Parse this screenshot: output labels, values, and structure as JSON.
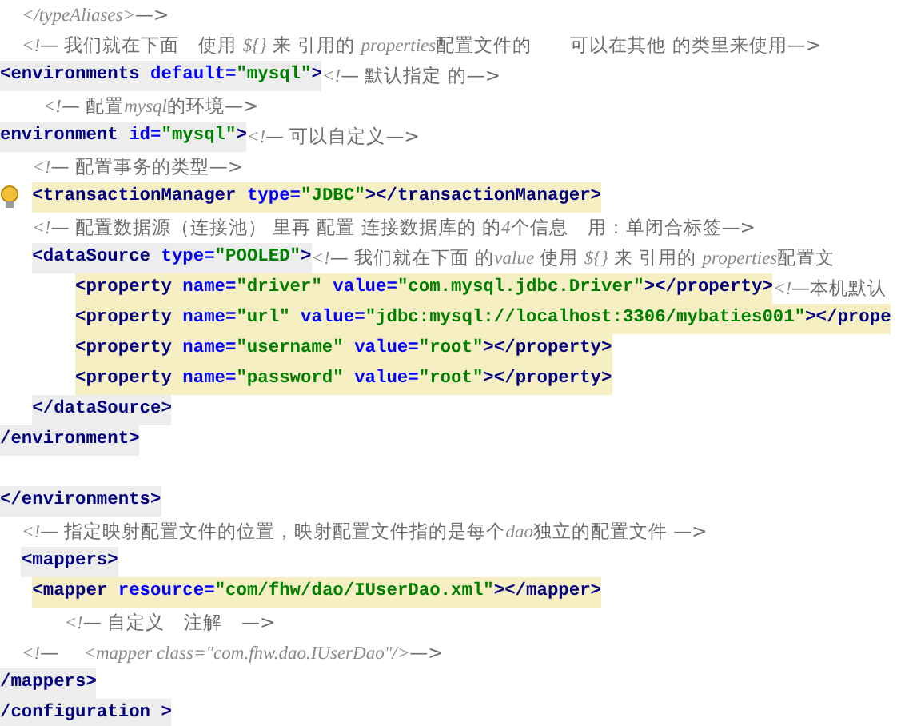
{
  "lines": [
    {
      "kind": "code",
      "comment": [
        {
          "kind": "italic",
          "text": "  </typeAliases>"
        },
        {
          "kind": "plain",
          "text": "—>"
        }
      ]
    },
    {
      "kind": "code",
      "comment": [
        {
          "kind": "italic",
          "text": "  <!"
        },
        {
          "kind": "plain",
          "text": "— 我们就在下面　使用 "
        },
        {
          "kind": "italic",
          "text": "${}"
        },
        {
          "kind": "plain",
          "text": " 来 引用的 "
        },
        {
          "kind": "italic",
          "text": "properties"
        },
        {
          "kind": "plain",
          "text": "配置文件的　　可以在其他 的类里来使用—>"
        }
      ]
    },
    {
      "kind": "code",
      "matched": false,
      "in_scope": true,
      "tokens": [
        {
          "kind": "tag",
          "text": "<environments "
        },
        {
          "kind": "attr",
          "text": "default="
        },
        {
          "kind": "value",
          "text": "\"mysql\""
        },
        {
          "kind": "tag",
          "text": ">"
        }
      ],
      "comment": [
        {
          "kind": "italic",
          "text": "<!"
        },
        {
          "kind": "plain",
          "text": "— 默认指定 的—>"
        }
      ]
    },
    {
      "kind": "code",
      "comment": [
        {
          "kind": "italic",
          "text": "    <!"
        },
        {
          "kind": "plain",
          "text": "— 配置"
        },
        {
          "kind": "italic",
          "text": "mysql"
        },
        {
          "kind": "plain",
          "text": "的环境—>"
        }
      ]
    },
    {
      "kind": "code",
      "matched": false,
      "in_scope": true,
      "tokens": [
        {
          "kind": "tag",
          "text": "environment "
        },
        {
          "kind": "attr",
          "text": "id="
        },
        {
          "kind": "value",
          "text": "\"mysql\""
        },
        {
          "kind": "tag",
          "text": ">"
        }
      ],
      "comment": [
        {
          "kind": "italic",
          "text": "<!"
        },
        {
          "kind": "plain",
          "text": "— 可以自定义—>"
        }
      ]
    },
    {
      "kind": "code",
      "comment": [
        {
          "kind": "italic",
          "text": "   <!"
        },
        {
          "kind": "plain",
          "text": "— 配置事务的类型—>"
        }
      ]
    },
    {
      "kind": "code",
      "bulb": true,
      "matched": true,
      "in_scope": false,
      "tokens": [
        {
          "kind": "tag",
          "text": "   <transactionManager "
        },
        {
          "kind": "attr",
          "text": "type="
        },
        {
          "kind": "value",
          "text": "\"JDBC\""
        },
        {
          "kind": "tag",
          "text": "></transactionManager>"
        }
      ]
    },
    {
      "kind": "code",
      "comment": [
        {
          "kind": "italic",
          "text": "   <!"
        },
        {
          "kind": "plain",
          "text": "— 配置数据源（连接池） 里再 配置 连接数据库的 的"
        },
        {
          "kind": "italic",
          "text": "4"
        },
        {
          "kind": "plain",
          "text": "个信息　用：单闭合标签—>"
        }
      ]
    },
    {
      "kind": "code",
      "matched": false,
      "in_scope": true,
      "tokens": [
        {
          "kind": "tag",
          "text": "   <dataSource "
        },
        {
          "kind": "attr",
          "text": "type="
        },
        {
          "kind": "value",
          "text": "\"POOLED\""
        },
        {
          "kind": "tag",
          "text": ">"
        }
      ],
      "comment": [
        {
          "kind": "italic",
          "text": "<!"
        },
        {
          "kind": "plain",
          "text": "— 我们就在下面 的"
        },
        {
          "kind": "italic",
          "text": "value"
        },
        {
          "kind": "plain",
          "text": " 使用 "
        },
        {
          "kind": "italic",
          "text": "${}"
        },
        {
          "kind": "plain",
          "text": " 来 引用的 "
        },
        {
          "kind": "italic",
          "text": "properties"
        },
        {
          "kind": "plain",
          "text": "配置文"
        }
      ]
    },
    {
      "kind": "code",
      "matched": true,
      "in_scope": false,
      "tokens": [
        {
          "kind": "tag",
          "text": "       <property "
        },
        {
          "kind": "attr",
          "text": "name="
        },
        {
          "kind": "value",
          "text": "\"driver\" "
        },
        {
          "kind": "attr",
          "text": "value="
        },
        {
          "kind": "value",
          "text": "\"com.mysql.jdbc.Driver\""
        },
        {
          "kind": "tag",
          "text": "></property>"
        }
      ],
      "comment": [
        {
          "kind": "italic",
          "text": "<!"
        },
        {
          "kind": "plain",
          "text": "—本机默认"
        }
      ]
    },
    {
      "kind": "code",
      "matched": true,
      "in_scope": false,
      "tokens": [
        {
          "kind": "tag",
          "text": "       <property "
        },
        {
          "kind": "attr",
          "text": "name="
        },
        {
          "kind": "value",
          "text": "\"url\" "
        },
        {
          "kind": "attr",
          "text": "value="
        },
        {
          "kind": "value",
          "text": "\"jdbc:mysql://localhost:3306/mybaties001\""
        },
        {
          "kind": "tag",
          "text": "></prope"
        }
      ]
    },
    {
      "kind": "code",
      "matched": true,
      "in_scope": false,
      "tokens": [
        {
          "kind": "tag",
          "text": "       <property "
        },
        {
          "kind": "attr",
          "text": "name="
        },
        {
          "kind": "value",
          "text": "\"username\" "
        },
        {
          "kind": "attr",
          "text": "value="
        },
        {
          "kind": "value",
          "text": "\"root\""
        },
        {
          "kind": "tag",
          "text": "></property>"
        }
      ]
    },
    {
      "kind": "code",
      "matched": true,
      "in_scope": false,
      "tokens": [
        {
          "kind": "tag",
          "text": "       <property "
        },
        {
          "kind": "attr",
          "text": "name="
        },
        {
          "kind": "value",
          "text": "\"password\" "
        },
        {
          "kind": "attr",
          "text": "value="
        },
        {
          "kind": "value",
          "text": "\"root\""
        },
        {
          "kind": "tag",
          "text": "></property>"
        }
      ]
    },
    {
      "kind": "code",
      "matched": false,
      "in_scope": true,
      "tokens": [
        {
          "kind": "tag",
          "text": "   </dataSource>"
        }
      ]
    },
    {
      "kind": "code",
      "matched": false,
      "in_scope": true,
      "tokens": [
        {
          "kind": "tag",
          "text": "/environment>"
        }
      ]
    },
    {
      "kind": "blank"
    },
    {
      "kind": "code",
      "matched": false,
      "in_scope": true,
      "tokens": [
        {
          "kind": "tag",
          "text": "</environments>"
        }
      ]
    },
    {
      "kind": "code",
      "comment": [
        {
          "kind": "italic",
          "text": "  <!"
        },
        {
          "kind": "plain",
          "text": "— 指定映射配置文件的位置，映射配置文件指的是每个"
        },
        {
          "kind": "italic",
          "text": "dao"
        },
        {
          "kind": "plain",
          "text": "独立的配置文件 —>"
        }
      ]
    },
    {
      "kind": "code",
      "matched": false,
      "in_scope": true,
      "tokens": [
        {
          "kind": "tag",
          "text": "  <mappers>"
        }
      ]
    },
    {
      "kind": "code",
      "matched": true,
      "in_scope": false,
      "tokens": [
        {
          "kind": "tag",
          "text": "   <mapper "
        },
        {
          "kind": "attr",
          "text": "resource="
        },
        {
          "kind": "value",
          "text": "\"com/fhw/dao/IUserDao.xml\""
        },
        {
          "kind": "tag",
          "text": "></mapper>"
        }
      ]
    },
    {
      "kind": "code",
      "comment": [
        {
          "kind": "italic",
          "text": "      <!"
        },
        {
          "kind": "plain",
          "text": "— 自定义　注解　—>"
        }
      ]
    },
    {
      "kind": "code",
      "comment": [
        {
          "kind": "italic",
          "text": "  <!"
        },
        {
          "kind": "plain",
          "text": "—　 "
        },
        {
          "kind": "italic",
          "text": "<mapper class=\"com.fhw.dao.IUserDao\"/>"
        },
        {
          "kind": "plain",
          "text": "—>"
        }
      ]
    },
    {
      "kind": "code",
      "matched": false,
      "in_scope": true,
      "tokens": [
        {
          "kind": "tag",
          "text": "/mappers>"
        }
      ]
    },
    {
      "kind": "code",
      "matched": false,
      "in_scope": true,
      "tokens": [
        {
          "kind": "tag",
          "text": "/configuration >"
        }
      ]
    }
  ]
}
